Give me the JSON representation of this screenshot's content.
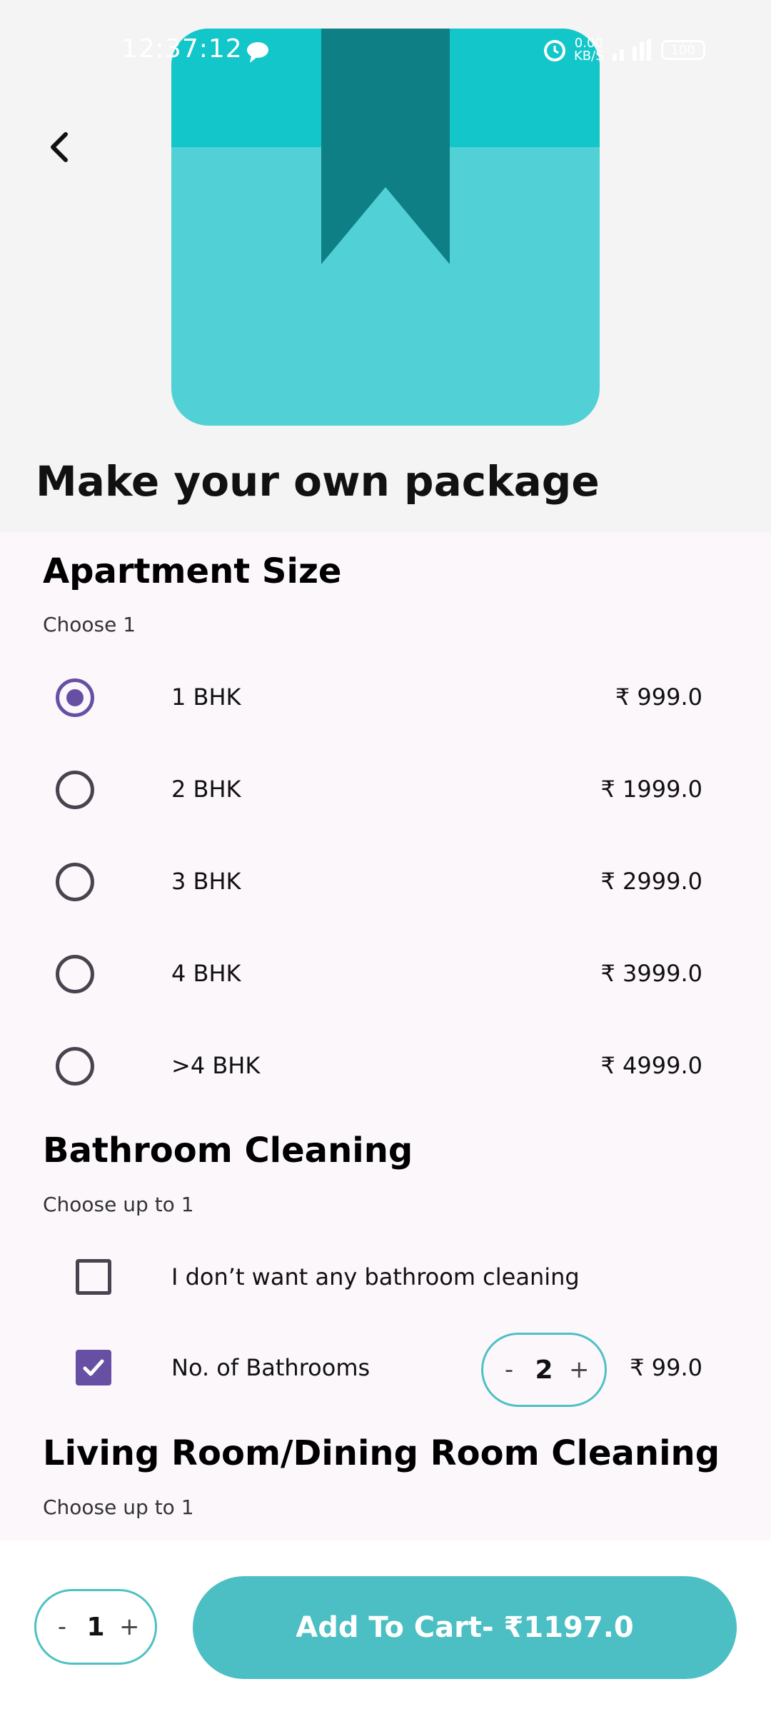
{
  "status_bar": {
    "time": "12:37:12",
    "net_speed_value": "0.00",
    "net_speed_unit": "KB/S",
    "battery": "100"
  },
  "header": {
    "title": "Make your own package"
  },
  "apartment": {
    "title": "Apartment Size",
    "subtitle": "Choose 1",
    "options": [
      {
        "label": "1 BHK",
        "price": "₹ 999.0"
      },
      {
        "label": "2 BHK",
        "price": "₹ 1999.0"
      },
      {
        "label": "3 BHK",
        "price": "₹ 2999.0"
      },
      {
        "label": "4 BHK",
        "price": "₹ 3999.0"
      },
      {
        "label": ">4 BHK",
        "price": "₹ 4999.0"
      }
    ]
  },
  "bathroom": {
    "title": "Bathroom Cleaning",
    "subtitle": "Choose up to 1",
    "none_label": "I don’t want any bathroom cleaning",
    "count_label": "No. of Bathrooms",
    "count_value": "2",
    "count_price": "₹ 99.0",
    "minus": "-",
    "plus": "+"
  },
  "living": {
    "title": "Living Room/Dining Room Cleaning",
    "subtitle": "Choose up to 1"
  },
  "bottom_bar": {
    "qty_minus": "-",
    "qty_value": "1",
    "qty_plus": "+",
    "cart_label": "Add To Cart- ₹1197.0"
  },
  "colors": {
    "accent": "#4cbfc4",
    "selection": "#6750a4",
    "content_bg": "#fcf7fb"
  }
}
